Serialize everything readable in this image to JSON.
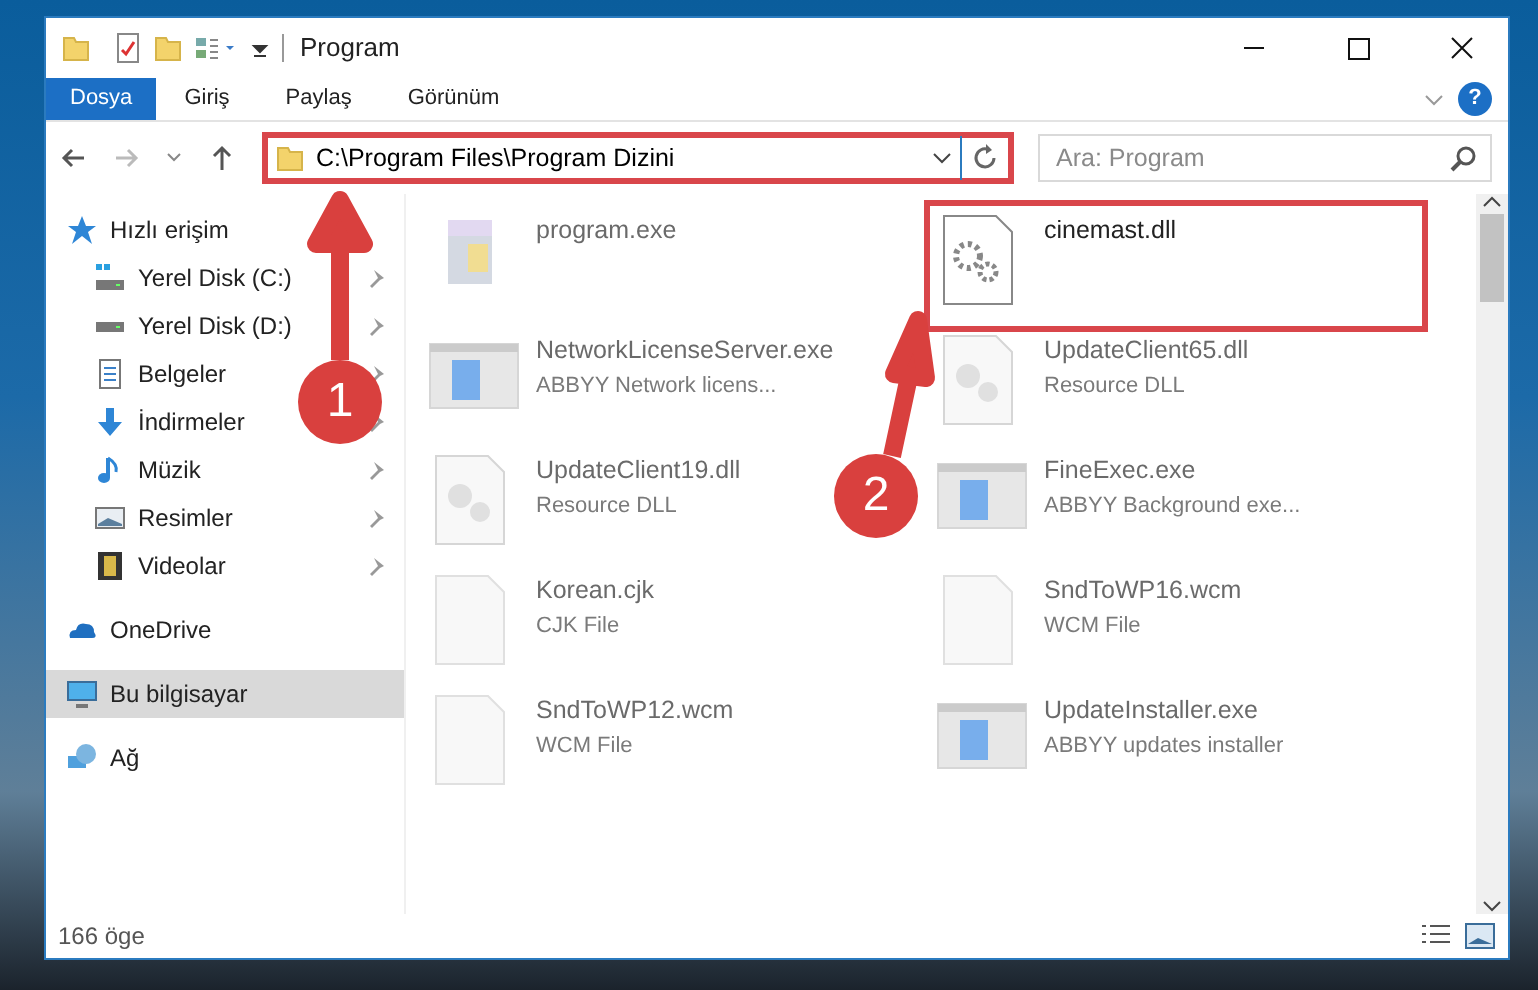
{
  "window": {
    "title": "Program"
  },
  "ribbon": {
    "tabs": [
      {
        "label": "Dosya",
        "selected": true
      },
      {
        "label": "Giriş",
        "selected": false
      },
      {
        "label": "Paylaş",
        "selected": false
      },
      {
        "label": "Görünüm",
        "selected": false
      }
    ],
    "help": "?"
  },
  "address": {
    "path": "C:\\Program Files\\Program Dizini",
    "highlighted": true
  },
  "search": {
    "placeholder": "Ara: Program"
  },
  "sidebar": {
    "items": [
      {
        "label": "Hızlı erişim",
        "kind": "quick",
        "selected": false,
        "children": [
          {
            "label": "Yerel Disk (C:)",
            "kind": "drivec",
            "pinned": true,
            "selected": false
          },
          {
            "label": "Yerel Disk (D:)",
            "kind": "drive",
            "pinned": true,
            "selected": false
          },
          {
            "label": "Belgeler",
            "kind": "docs",
            "pinned": true,
            "selected": false
          },
          {
            "label": "İndirmeler",
            "kind": "download",
            "pinned": true,
            "selected": false
          },
          {
            "label": "Müzik",
            "kind": "music",
            "pinned": true,
            "selected": false
          },
          {
            "label": "Resimler",
            "kind": "pictures",
            "pinned": true,
            "selected": false
          },
          {
            "label": "Videolar",
            "kind": "video",
            "pinned": true,
            "selected": false
          }
        ]
      },
      {
        "label": "OneDrive",
        "kind": "cloud",
        "selected": false
      },
      {
        "label": "Bu bilgisayar",
        "kind": "pc",
        "selected": true
      },
      {
        "label": "Ağ",
        "kind": "network",
        "selected": false
      }
    ]
  },
  "files": [
    {
      "name": "program.exe",
      "kind": "installer",
      "dimmed": true,
      "highlighted": false
    },
    {
      "name": "cinemast.dll",
      "kind": "gear",
      "dimmed": false,
      "highlighted": true
    },
    {
      "name": "NetworkLicenseServer.exe",
      "description": "ABBYY Network licens...",
      "kind": "app",
      "dimmed": true,
      "highlighted": false
    },
    {
      "name": "UpdateClient65.dll",
      "description": "Resource DLL",
      "kind": "dll",
      "dimmed": true,
      "highlighted": false
    },
    {
      "name": "UpdateClient19.dll",
      "description": "Resource DLL",
      "kind": "dll",
      "dimmed": true,
      "highlighted": false
    },
    {
      "name": "FineExec.exe",
      "description": "ABBYY Background exe...",
      "kind": "app",
      "dimmed": true,
      "highlighted": false
    },
    {
      "name": "Korean.cjk",
      "description": "CJK File",
      "kind": "blank",
      "dimmed": true,
      "highlighted": false
    },
    {
      "name": "SndToWP16.wcm",
      "description": "WCM File",
      "kind": "blank",
      "dimmed": true,
      "highlighted": false
    },
    {
      "name": "SndToWP12.wcm",
      "description": "WCM File",
      "kind": "blank",
      "dimmed": true,
      "highlighted": false
    },
    {
      "name": "UpdateInstaller.exe",
      "description": "ABBYY updates installer",
      "kind": "app",
      "dimmed": true,
      "highlighted": false
    }
  ],
  "status_bar": {
    "count": "166 öge"
  },
  "annotations": [
    {
      "label": "1"
    },
    {
      "label": "2"
    }
  ]
}
